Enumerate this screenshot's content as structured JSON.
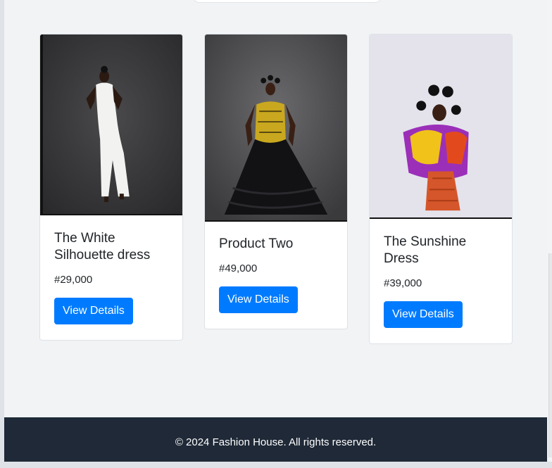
{
  "products": [
    {
      "title": "The White Silhouette dress",
      "price": "#29,000",
      "button_label": "View Details",
      "image": "woman in white silhouette dress"
    },
    {
      "title": "Product Two",
      "price": "#49,000",
      "button_label": "View Details",
      "image": "woman in black ruffled gown with yellow corset"
    },
    {
      "title": "The Sunshine Dress",
      "price": "#39,000",
      "button_label": "View Details",
      "image": "woman in feathered colorful wrap and orange dress"
    }
  ],
  "footer": {
    "text": "© 2024 Fashion House. All rights reserved."
  },
  "colors": {
    "accent": "#007bff",
    "footer_bg": "#1f2937",
    "page_bg": "#f1f3f5"
  }
}
